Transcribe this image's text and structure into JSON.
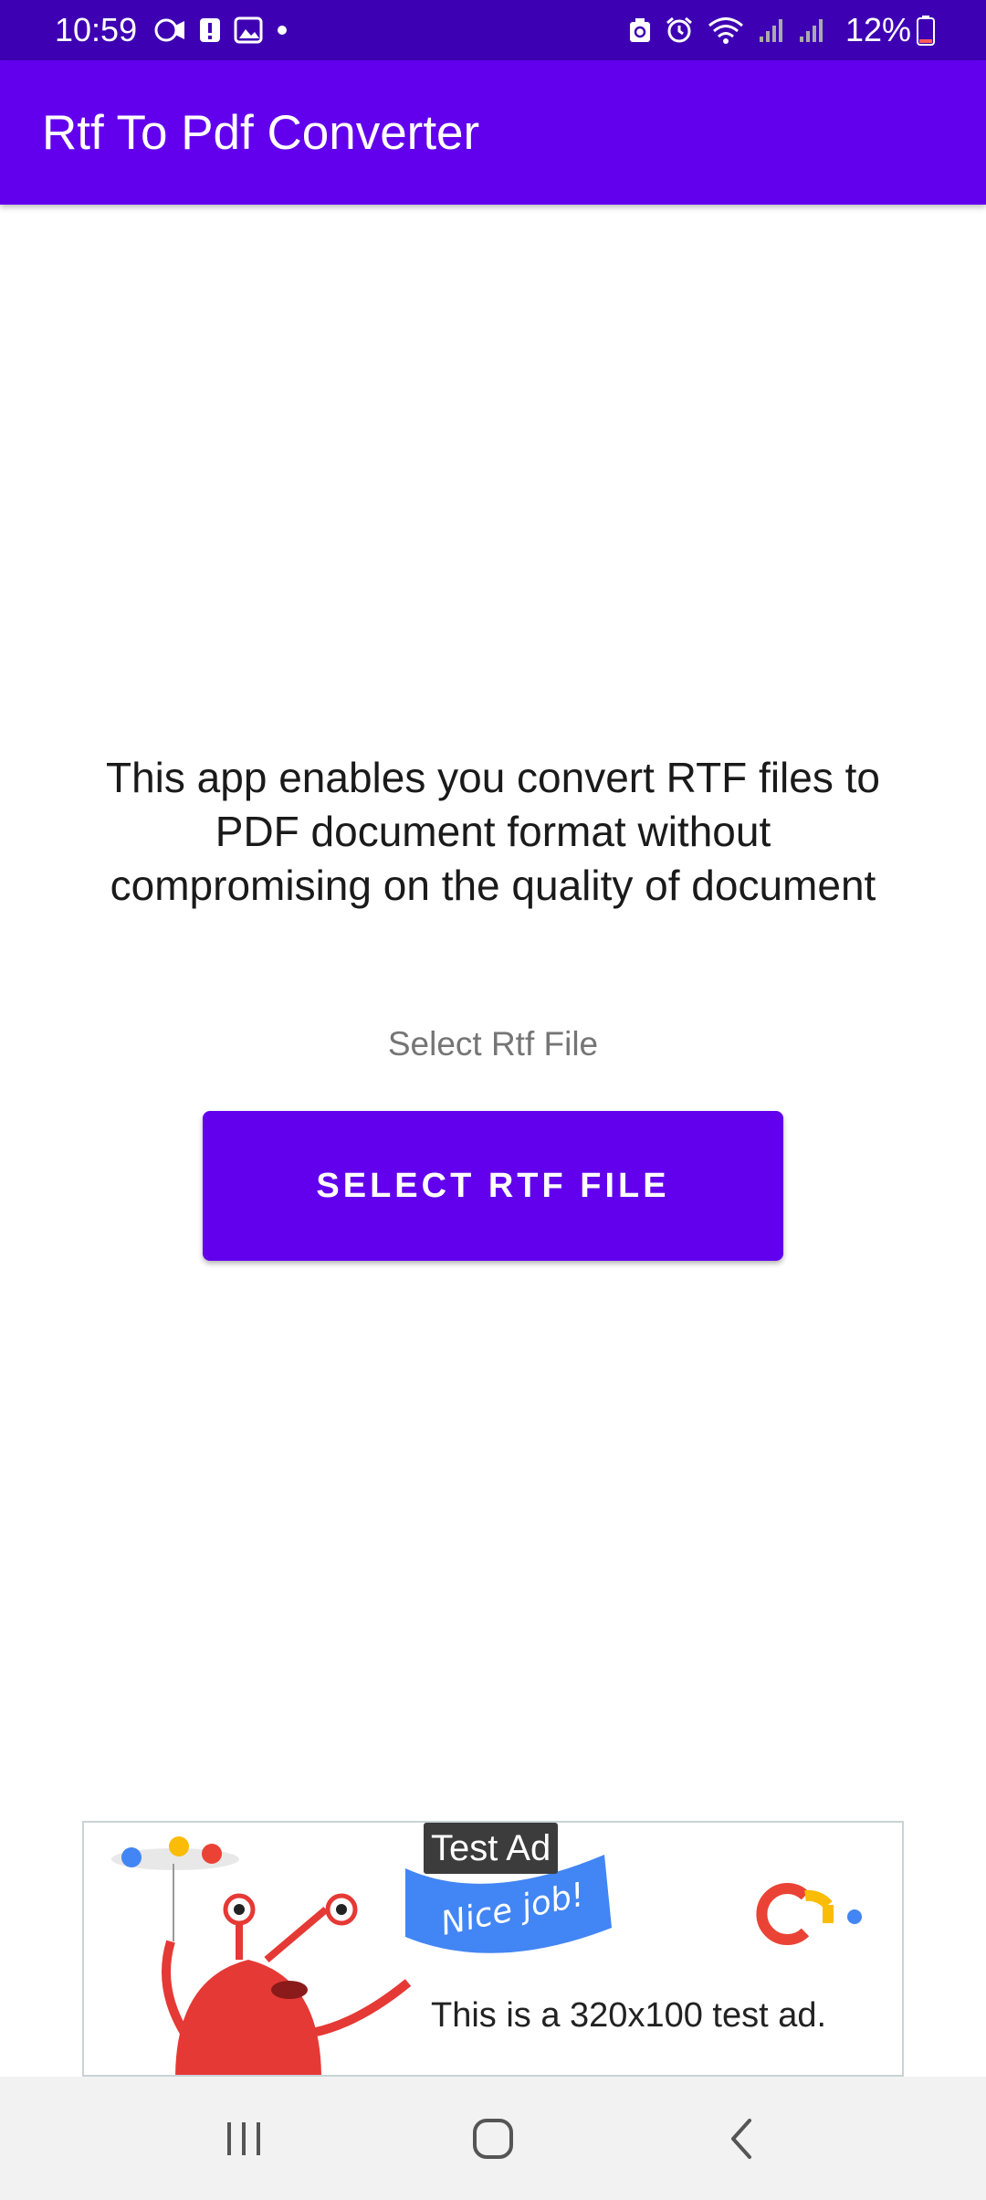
{
  "status_bar": {
    "time": "10:59",
    "battery": "12%",
    "left_icons": [
      "video-call-icon",
      "alert-icon",
      "image-icon",
      "dot-icon"
    ],
    "right_icons": [
      "recycle-icon",
      "alarm-icon",
      "wifi-icon",
      "signal-icon",
      "signal-icon",
      "battery-icon"
    ]
  },
  "app_bar": {
    "title": "Rtf To Pdf Converter",
    "background": "#6200ee"
  },
  "main": {
    "description": "This app  enables you convert RTF files to PDF document format without compromising on the quality of document",
    "select_label": "Select Rtf File",
    "select_button": "SELECT RTF FILE"
  },
  "ad": {
    "label": "Test Ad",
    "text": "This is a 320x100 test ad.",
    "banner_flag_text": "Nice job!"
  },
  "nav_bar": {
    "icons": [
      "recents-icon",
      "home-icon",
      "back-icon"
    ]
  }
}
